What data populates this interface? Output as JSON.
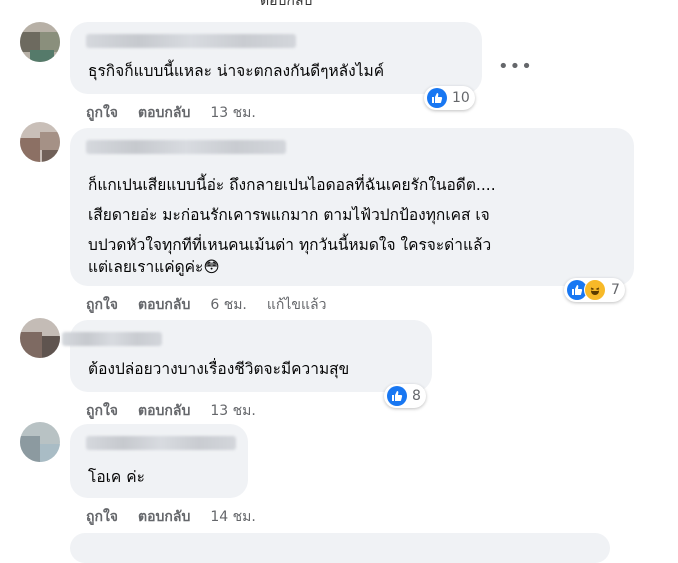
{
  "header_fragment": "ตอบกลับ",
  "comments": [
    {
      "lines": [
        "ธุรกิจก็แบบนี้แหละ น่าจะตกลงกันดีๆหลังไมค์"
      ],
      "reaction_count": "10",
      "actions": {
        "like": "ถูกใจ",
        "reply": "ตอบกลับ",
        "time": "13 ชม."
      }
    },
    {
      "lines": [
        "ก็แกเปนเสียแบบนี้อ่ะ ถึงกลายเปนไอดอลที่ฉันเคยรักในอดีต....",
        "เสียดายอ่ะ มะก่อนรักเคารพแกมาก ตามไฟ้วปกป้องทุกเคส เจ",
        "บปวดหัวใจทุกทีที่เหนคนเม้นด่า ทุกวันนี้หมดใจ ใครจะด่าแล้ว",
        "แต่เลยเราแค่ดูค่ะ😳"
      ],
      "reaction_count": "7",
      "actions": {
        "like": "ถูกใจ",
        "reply": "ตอบกลับ",
        "time": "6 ชม.",
        "edited": "แก้ไขแล้ว"
      }
    },
    {
      "lines": [
        "ต้องปล่อยวางบางเรื่องชีวิตจะมีความสุข"
      ],
      "reaction_count": "8",
      "actions": {
        "like": "ถูกใจ",
        "reply": "ตอบกลับ",
        "time": "13 ชม."
      }
    },
    {
      "lines": [
        "โอเค ค่ะ"
      ],
      "actions": {
        "like": "ถูกใจ",
        "reply": "ตอบกลับ",
        "time": "14 ชม."
      }
    }
  ],
  "icons": {
    "like": "thumbs-up-icon",
    "haha": "haha-emoji-icon",
    "more": "more-options-icon"
  },
  "colors": {
    "bubble": "#f0f2f5",
    "meta": "#65676b",
    "like_blue": "#1877f2"
  }
}
